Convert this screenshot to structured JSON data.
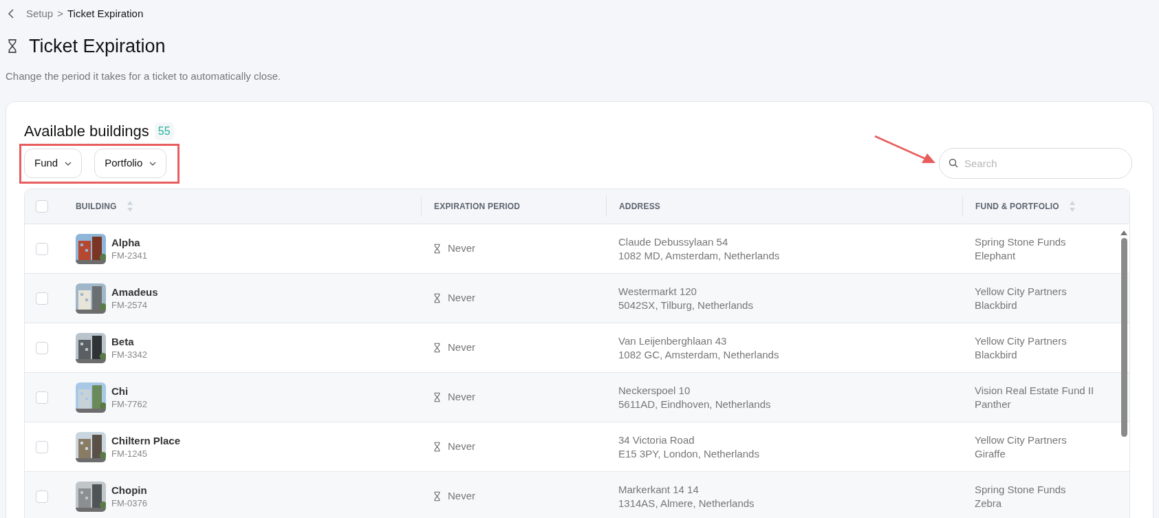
{
  "breadcrumb": {
    "parent": "Setup",
    "separator": ">",
    "current": "Ticket Expiration"
  },
  "page": {
    "title": "Ticket Expiration",
    "description": "Change the period it takes for a ticket to automatically close."
  },
  "buildings": {
    "title": "Available buildings",
    "count": "55",
    "filters": [
      "Fund",
      "Portfolio"
    ],
    "search": {
      "placeholder": "Search"
    },
    "table": {
      "columns": [
        {
          "label": "BUILDING",
          "sortable": true
        },
        {
          "label": "EXPIRATION PERIOD",
          "sortable": false
        },
        {
          "label": "ADDRESS",
          "sortable": false
        },
        {
          "label": "FUND & PORTFOLIO",
          "sortable": true
        }
      ],
      "header_checked": false,
      "rows": [
        {
          "name": "Alpha",
          "code": "FM-2341",
          "checked": false,
          "expiration": "Never",
          "address_line1": "Claude Debussylaan 54",
          "address_line2": "1082 MD, Amsterdam, Netherlands",
          "fund": "Spring Stone Funds",
          "portfolio": "Elephant"
        },
        {
          "name": "Amadeus",
          "code": "FM-2574",
          "checked": false,
          "expiration": "Never",
          "address_line1": "Westermarkt 120",
          "address_line2": "5042SX, Tilburg, Netherlands",
          "fund": "Yellow City Partners",
          "portfolio": "Blackbird"
        },
        {
          "name": "Beta",
          "code": "FM-3342",
          "checked": false,
          "expiration": "Never",
          "address_line1": "Van Leijenberghlaan 43",
          "address_line2": "1082 GC, Amsterdam, Netherlands",
          "fund": "Yellow City Partners",
          "portfolio": "Blackbird"
        },
        {
          "name": "Chi",
          "code": "FM-7762",
          "checked": false,
          "expiration": "Never",
          "address_line1": "Neckerspoel 10",
          "address_line2": "5611AD, Eindhoven, Netherlands",
          "fund": "Vision Real Estate Fund II",
          "portfolio": "Panther"
        },
        {
          "name": "Chiltern Place",
          "code": "FM-1245",
          "checked": false,
          "expiration": "Never",
          "address_line1": "34 Victoria Road",
          "address_line2": "E15 3PY, London, Netherlands",
          "fund": "Yellow City Partners",
          "portfolio": "Giraffe"
        },
        {
          "name": "Chopin",
          "code": "FM-0376",
          "checked": false,
          "expiration": "Never",
          "address_line1": "Markerkant 14 14",
          "address_line2": "1314AS, Almere, Netherlands",
          "fund": "Spring Stone Funds",
          "portfolio": "Zebra"
        }
      ]
    }
  }
}
